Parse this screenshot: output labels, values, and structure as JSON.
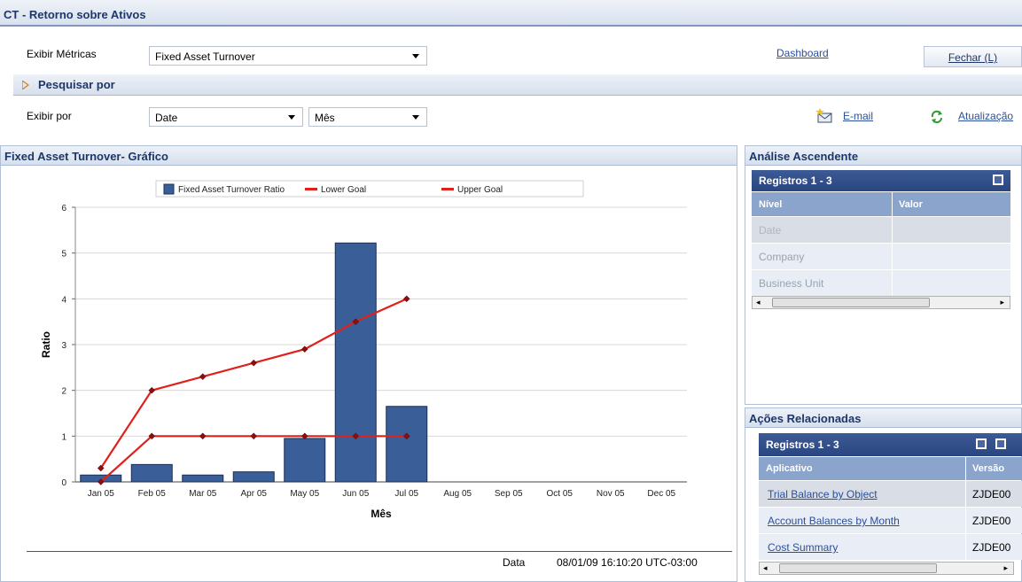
{
  "window": {
    "title": "CT - Retorno sobre Ativos"
  },
  "toolbar": {
    "metrics_label": "Exibir Métricas",
    "metrics_value": "Fixed Asset Turnover",
    "dashboard_link": "Dashboard",
    "close_button": "Fechar (L)"
  },
  "search": {
    "label": "Pesquisar por"
  },
  "filters": {
    "view_by_label": "Exibir por",
    "view_by_value": "Date",
    "period_value": "Mês",
    "email_link": "E-mail",
    "refresh_link": "Atualização"
  },
  "chart_panel": {
    "title": "Fixed Asset Turnover- Gráfico",
    "footer_label": "Data",
    "footer_value": "08/01/09 16:10:20 UTC-03:00"
  },
  "chart_data": {
    "type": "bar",
    "categories": [
      "Jan 05",
      "Feb 05",
      "Mar 05",
      "Apr 05",
      "May 05",
      "Jun 05",
      "Jul 05",
      "Aug 05",
      "Sep 05",
      "Oct 05",
      "Nov 05",
      "Dec 05"
    ],
    "series": [
      {
        "name": "Fixed Asset Turnover Ratio",
        "type": "bar",
        "color": "#3a5f98",
        "values": [
          0.15,
          0.38,
          0.15,
          0.22,
          0.95,
          5.22,
          1.65,
          null,
          null,
          null,
          null,
          null
        ]
      },
      {
        "name": "Lower Goal",
        "type": "line",
        "color": "#e0201b",
        "values": [
          0,
          1,
          1,
          1,
          1,
          1,
          1,
          null,
          null,
          null,
          null,
          null
        ]
      },
      {
        "name": "Upper Goal",
        "type": "line",
        "color": "#e0201b",
        "values": [
          0.3,
          2,
          2.3,
          2.6,
          2.9,
          3.5,
          4,
          null,
          null,
          null,
          null,
          null
        ]
      }
    ],
    "xlabel": "Mês",
    "ylabel": "Ratio",
    "ylim": [
      0,
      6
    ],
    "yticks": [
      0,
      1,
      2,
      3,
      4,
      5,
      6
    ],
    "grid": true,
    "legend": "top"
  },
  "ascending": {
    "title": "Análise Ascendente",
    "records": "Registros 1 - 3",
    "columns": [
      "Nível",
      "Valor"
    ],
    "rows": [
      "Date",
      "Company",
      "Business Unit"
    ]
  },
  "related": {
    "title": "Ações Relacionadas",
    "records": "Registros 1 - 3",
    "columns": [
      "Aplicativo",
      "Versão"
    ],
    "rows": [
      {
        "app": "Trial Balance by Object",
        "version": "ZJDE00"
      },
      {
        "app": "Account Balances by Month",
        "version": "ZJDE00"
      },
      {
        "app": "Cost Summary",
        "version": "ZJDE00"
      }
    ]
  },
  "icons": {
    "email": "email-icon",
    "refresh": "refresh-icon",
    "expand": "expand-arrow-icon",
    "maximize": "maximize-icon",
    "export": "export-icon"
  }
}
